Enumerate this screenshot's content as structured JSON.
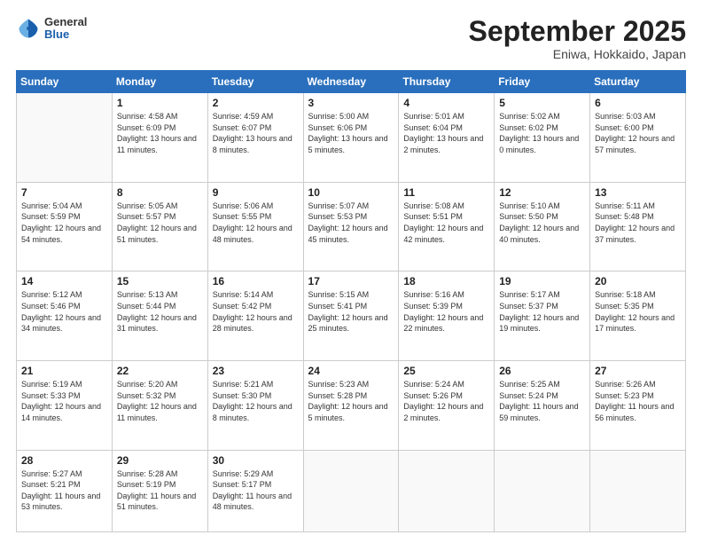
{
  "header": {
    "logo": {
      "general": "General",
      "blue": "Blue"
    },
    "title": "September 2025",
    "subtitle": "Eniwa, Hokkaido, Japan"
  },
  "weekdays": [
    "Sunday",
    "Monday",
    "Tuesday",
    "Wednesday",
    "Thursday",
    "Friday",
    "Saturday"
  ],
  "weeks": [
    [
      {
        "day": "",
        "sunrise": "",
        "sunset": "",
        "daylight": ""
      },
      {
        "day": "1",
        "sunrise": "Sunrise: 4:58 AM",
        "sunset": "Sunset: 6:09 PM",
        "daylight": "Daylight: 13 hours and 11 minutes."
      },
      {
        "day": "2",
        "sunrise": "Sunrise: 4:59 AM",
        "sunset": "Sunset: 6:07 PM",
        "daylight": "Daylight: 13 hours and 8 minutes."
      },
      {
        "day": "3",
        "sunrise": "Sunrise: 5:00 AM",
        "sunset": "Sunset: 6:06 PM",
        "daylight": "Daylight: 13 hours and 5 minutes."
      },
      {
        "day": "4",
        "sunrise": "Sunrise: 5:01 AM",
        "sunset": "Sunset: 6:04 PM",
        "daylight": "Daylight: 13 hours and 2 minutes."
      },
      {
        "day": "5",
        "sunrise": "Sunrise: 5:02 AM",
        "sunset": "Sunset: 6:02 PM",
        "daylight": "Daylight: 13 hours and 0 minutes."
      },
      {
        "day": "6",
        "sunrise": "Sunrise: 5:03 AM",
        "sunset": "Sunset: 6:00 PM",
        "daylight": "Daylight: 12 hours and 57 minutes."
      }
    ],
    [
      {
        "day": "7",
        "sunrise": "Sunrise: 5:04 AM",
        "sunset": "Sunset: 5:59 PM",
        "daylight": "Daylight: 12 hours and 54 minutes."
      },
      {
        "day": "8",
        "sunrise": "Sunrise: 5:05 AM",
        "sunset": "Sunset: 5:57 PM",
        "daylight": "Daylight: 12 hours and 51 minutes."
      },
      {
        "day": "9",
        "sunrise": "Sunrise: 5:06 AM",
        "sunset": "Sunset: 5:55 PM",
        "daylight": "Daylight: 12 hours and 48 minutes."
      },
      {
        "day": "10",
        "sunrise": "Sunrise: 5:07 AM",
        "sunset": "Sunset: 5:53 PM",
        "daylight": "Daylight: 12 hours and 45 minutes."
      },
      {
        "day": "11",
        "sunrise": "Sunrise: 5:08 AM",
        "sunset": "Sunset: 5:51 PM",
        "daylight": "Daylight: 12 hours and 42 minutes."
      },
      {
        "day": "12",
        "sunrise": "Sunrise: 5:10 AM",
        "sunset": "Sunset: 5:50 PM",
        "daylight": "Daylight: 12 hours and 40 minutes."
      },
      {
        "day": "13",
        "sunrise": "Sunrise: 5:11 AM",
        "sunset": "Sunset: 5:48 PM",
        "daylight": "Daylight: 12 hours and 37 minutes."
      }
    ],
    [
      {
        "day": "14",
        "sunrise": "Sunrise: 5:12 AM",
        "sunset": "Sunset: 5:46 PM",
        "daylight": "Daylight: 12 hours and 34 minutes."
      },
      {
        "day": "15",
        "sunrise": "Sunrise: 5:13 AM",
        "sunset": "Sunset: 5:44 PM",
        "daylight": "Daylight: 12 hours and 31 minutes."
      },
      {
        "day": "16",
        "sunrise": "Sunrise: 5:14 AM",
        "sunset": "Sunset: 5:42 PM",
        "daylight": "Daylight: 12 hours and 28 minutes."
      },
      {
        "day": "17",
        "sunrise": "Sunrise: 5:15 AM",
        "sunset": "Sunset: 5:41 PM",
        "daylight": "Daylight: 12 hours and 25 minutes."
      },
      {
        "day": "18",
        "sunrise": "Sunrise: 5:16 AM",
        "sunset": "Sunset: 5:39 PM",
        "daylight": "Daylight: 12 hours and 22 minutes."
      },
      {
        "day": "19",
        "sunrise": "Sunrise: 5:17 AM",
        "sunset": "Sunset: 5:37 PM",
        "daylight": "Daylight: 12 hours and 19 minutes."
      },
      {
        "day": "20",
        "sunrise": "Sunrise: 5:18 AM",
        "sunset": "Sunset: 5:35 PM",
        "daylight": "Daylight: 12 hours and 17 minutes."
      }
    ],
    [
      {
        "day": "21",
        "sunrise": "Sunrise: 5:19 AM",
        "sunset": "Sunset: 5:33 PM",
        "daylight": "Daylight: 12 hours and 14 minutes."
      },
      {
        "day": "22",
        "sunrise": "Sunrise: 5:20 AM",
        "sunset": "Sunset: 5:32 PM",
        "daylight": "Daylight: 12 hours and 11 minutes."
      },
      {
        "day": "23",
        "sunrise": "Sunrise: 5:21 AM",
        "sunset": "Sunset: 5:30 PM",
        "daylight": "Daylight: 12 hours and 8 minutes."
      },
      {
        "day": "24",
        "sunrise": "Sunrise: 5:23 AM",
        "sunset": "Sunset: 5:28 PM",
        "daylight": "Daylight: 12 hours and 5 minutes."
      },
      {
        "day": "25",
        "sunrise": "Sunrise: 5:24 AM",
        "sunset": "Sunset: 5:26 PM",
        "daylight": "Daylight: 12 hours and 2 minutes."
      },
      {
        "day": "26",
        "sunrise": "Sunrise: 5:25 AM",
        "sunset": "Sunset: 5:24 PM",
        "daylight": "Daylight: 11 hours and 59 minutes."
      },
      {
        "day": "27",
        "sunrise": "Sunrise: 5:26 AM",
        "sunset": "Sunset: 5:23 PM",
        "daylight": "Daylight: 11 hours and 56 minutes."
      }
    ],
    [
      {
        "day": "28",
        "sunrise": "Sunrise: 5:27 AM",
        "sunset": "Sunset: 5:21 PM",
        "daylight": "Daylight: 11 hours and 53 minutes."
      },
      {
        "day": "29",
        "sunrise": "Sunrise: 5:28 AM",
        "sunset": "Sunset: 5:19 PM",
        "daylight": "Daylight: 11 hours and 51 minutes."
      },
      {
        "day": "30",
        "sunrise": "Sunrise: 5:29 AM",
        "sunset": "Sunset: 5:17 PM",
        "daylight": "Daylight: 11 hours and 48 minutes."
      },
      {
        "day": "",
        "sunrise": "",
        "sunset": "",
        "daylight": ""
      },
      {
        "day": "",
        "sunrise": "",
        "sunset": "",
        "daylight": ""
      },
      {
        "day": "",
        "sunrise": "",
        "sunset": "",
        "daylight": ""
      },
      {
        "day": "",
        "sunrise": "",
        "sunset": "",
        "daylight": ""
      }
    ]
  ]
}
